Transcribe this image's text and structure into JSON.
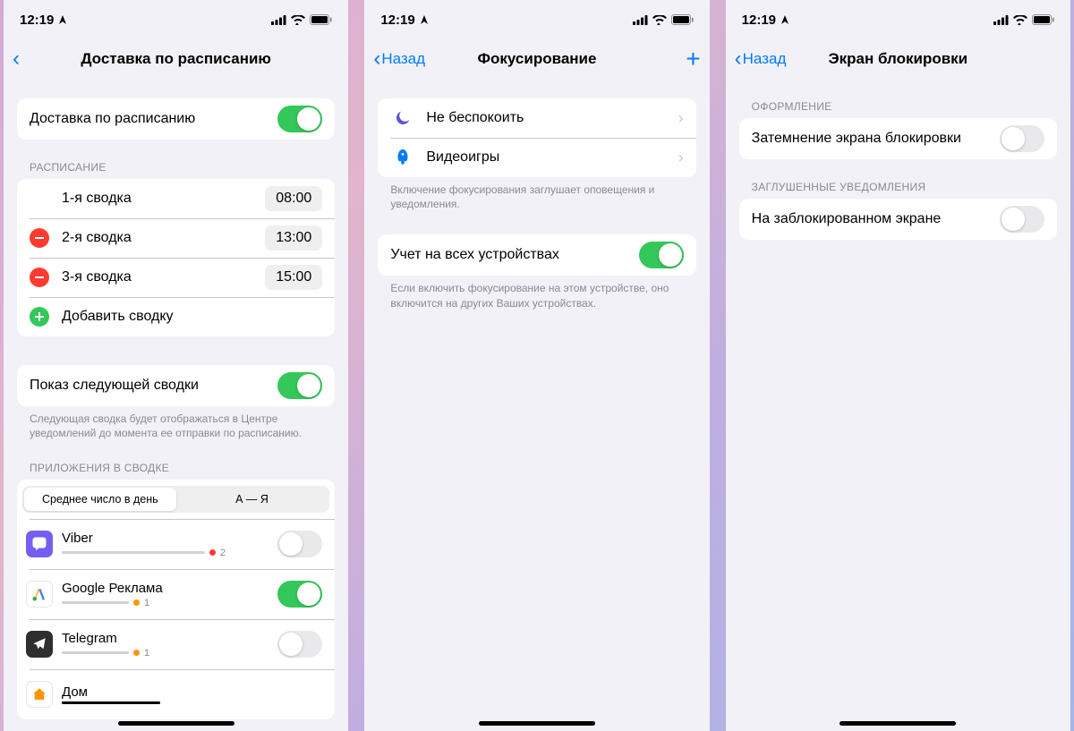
{
  "status": {
    "time": "12:19"
  },
  "p1": {
    "title": "Доставка по расписанию",
    "main_toggle": "Доставка по расписанию",
    "sched_header": "РАСПИСАНИЕ",
    "rows": [
      {
        "label": "1-я сводка",
        "time": "08:00"
      },
      {
        "label": "2-я сводка",
        "time": "13:00"
      },
      {
        "label": "3-я сводка",
        "time": "15:00"
      }
    ],
    "add": "Добавить сводку",
    "next_summary": "Показ следующей сводки",
    "next_footer": "Следующая сводка будет отображаться в Центре уведомлений до момента ее отправки по расписанию.",
    "apps_header": "ПРИЛОЖЕНИЯ В СВОДКЕ",
    "seg": [
      "Среднее число в день",
      "А — Я"
    ],
    "apps": [
      {
        "name": "Viber",
        "count": "2",
        "fill": 90,
        "color": "#FF3B30",
        "on": false,
        "bg": "#7360F2"
      },
      {
        "name": "Google Реклама",
        "count": "1",
        "fill": 45,
        "color": "#FF9500",
        "on": true,
        "bg": "#FFFFFF"
      },
      {
        "name": "Telegram",
        "count": "1",
        "fill": 45,
        "color": "#FF9500",
        "on": false,
        "bg": "#2F2F2F"
      },
      {
        "name": "Дом",
        "count": "",
        "fill": 55,
        "color": "#000",
        "on": false,
        "bg": "#FFFFFF"
      }
    ]
  },
  "p2": {
    "back": "Назад",
    "title": "Фокусирование",
    "items": [
      {
        "label": "Не беспокоить"
      },
      {
        "label": "Видеоигры"
      }
    ],
    "footer1": "Включение фокусирования заглушает оповещения и уведомления.",
    "share": "Учет на всех устройствах",
    "footer2": "Если включить фокусирование на этом устройстве, оно включится на других Ваших устройствах."
  },
  "p3": {
    "back": "Назад",
    "title": "Экран блокировки",
    "h1": "ОФОРМЛЕНИЕ",
    "r1": "Затемнение экрана блокировки",
    "h2": "ЗАГЛУШЕННЫЕ УВЕДОМЛЕНИЯ",
    "r2": "На заблокированном экране"
  }
}
